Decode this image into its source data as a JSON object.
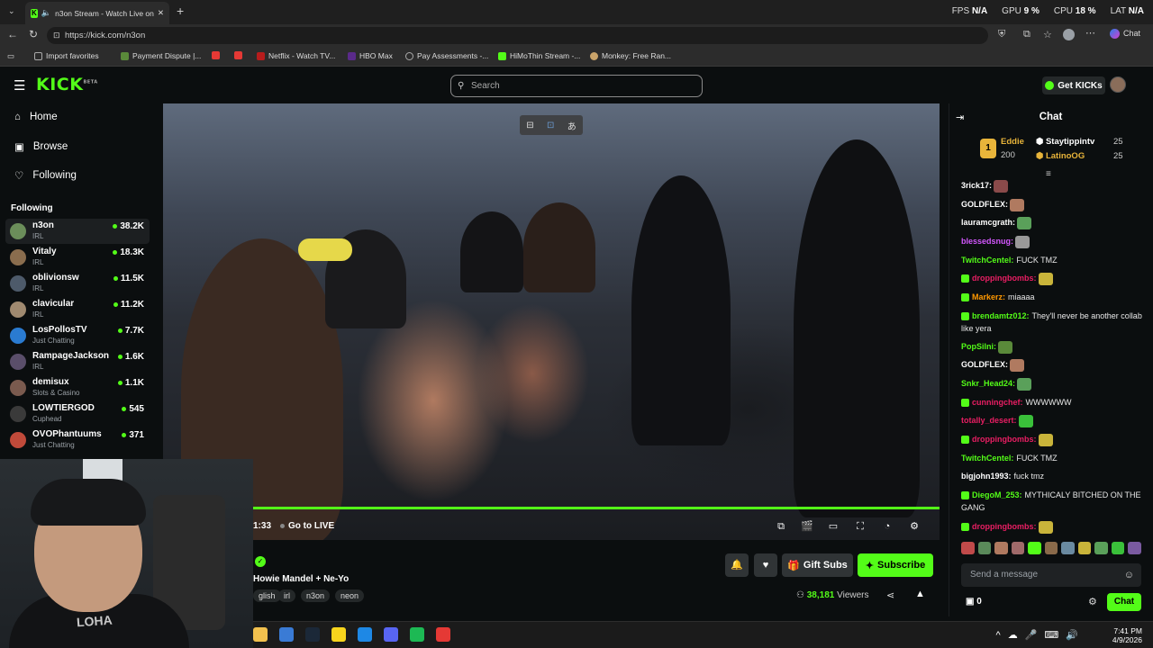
{
  "browser": {
    "tab_title": "n3on Stream - Watch Live on",
    "url": "https://kick.com/n3on",
    "stats": [
      {
        "label": "FPS",
        "value": "N/A"
      },
      {
        "label": "GPU",
        "value": "9 %"
      },
      {
        "label": "CPU",
        "value": "18 %"
      },
      {
        "label": "LAT",
        "value": "N/A"
      }
    ],
    "copilot_label": "Chat",
    "bookmarks": [
      "Import favorites",
      "Payment Dispute |...",
      "Netflix - Watch TV...",
      "HBO Max",
      "Pay Assessments -...",
      "HiMoThin Stream -...",
      "Monkey: Free Ran..."
    ]
  },
  "kick": {
    "logo": "KICK",
    "logo_sup": "BETA",
    "search_placeholder": "Search",
    "get_kicks": "Get KICKs"
  },
  "sidebar": {
    "nav": [
      {
        "label": "Home",
        "icon": "home-icon"
      },
      {
        "label": "Browse",
        "icon": "browse-icon"
      },
      {
        "label": "Following",
        "icon": "heart-icon"
      }
    ],
    "following_heading": "Following",
    "channels": [
      {
        "name": "n3on",
        "category": "IRL",
        "viewers": "38.2K",
        "color": "#6b8e5a"
      },
      {
        "name": "Vitaly",
        "category": "IRL",
        "viewers": "18.3K",
        "color": "#8a6d4e"
      },
      {
        "name": "oblivionsw",
        "category": "IRL",
        "viewers": "11.5K",
        "color": "#4d5a6a"
      },
      {
        "name": "clavicular",
        "category": "IRL",
        "viewers": "11.2K",
        "color": "#a08a70"
      },
      {
        "name": "LosPollosTV",
        "category": "Just Chatting",
        "viewers": "7.7K",
        "color": "#2a7bd1"
      },
      {
        "name": "RampageJackson",
        "category": "IRL",
        "viewers": "1.6K",
        "color": "#5a4e6a"
      },
      {
        "name": "demisux",
        "category": "Slots & Casino",
        "viewers": "1.1K",
        "color": "#7a5a4e"
      },
      {
        "name": "LOWTIERGOD",
        "category": "Cuphead",
        "viewers": "545",
        "color": "#3a3a3a"
      },
      {
        "name": "OVOPhantuums",
        "category": "Just Chatting",
        "viewers": "371",
        "color": "#c04a3a"
      }
    ]
  },
  "player": {
    "timecode": "1:33",
    "go_live": "Go to LIVE"
  },
  "stream": {
    "title": "Howie Mandel + Ne-Yo",
    "tags": [
      "glish",
      "irl",
      "n3on",
      "neon"
    ],
    "viewers_count": "38,181",
    "viewers_label": "Viewers",
    "gift_subs": "Gift Subs",
    "subscribe": "Subscribe"
  },
  "chat": {
    "title": "Chat",
    "pinned": [
      {
        "rank": "1",
        "name": "Eddie",
        "amount": "200",
        "color": "#e8b43a"
      },
      {
        "name": "Staytippintv",
        "amount": "25",
        "color": "#ffffff"
      },
      {
        "name": "LatinoOG",
        "amount": "25",
        "color": "#e8b43a"
      }
    ],
    "messages": [
      {
        "user": "3rick17:",
        "text": "",
        "color": "#ffffff",
        "emote": "#8a4a4a",
        "badge": false
      },
      {
        "user": "GOLDFLEX:",
        "text": "",
        "color": "#ffffff",
        "emote": "#b07a60",
        "badge": false
      },
      {
        "user": "lauramcgrath:",
        "text": "",
        "color": "#ffffff",
        "emote": "#5aa05a",
        "badge": false
      },
      {
        "user": "blessedsnug:",
        "text": "",
        "color": "#d357fe",
        "emote": "#999999",
        "badge": false
      },
      {
        "user": "TwitchCentel:",
        "text": "FUCK TMZ",
        "color": "#53fc18",
        "emote": "",
        "badge": false
      },
      {
        "user": "droppingbombs:",
        "text": "",
        "color": "#e91e63",
        "emote": "#c9b43a",
        "badge": true
      },
      {
        "user": "Markerz:",
        "text": "miaaaa",
        "color": "#ff9800",
        "emote": "",
        "badge": true
      },
      {
        "user": "brendamtz012:",
        "text": "They'll never be another collab like yera",
        "color": "#53fc18",
        "emote": "",
        "badge": true
      },
      {
        "user": "PopSilni:",
        "text": "",
        "color": "#53fc18",
        "emote": "#5a8a3a",
        "badge": false
      },
      {
        "user": "GOLDFLEX:",
        "text": "",
        "color": "#ffffff",
        "emote": "#b07a60",
        "badge": false
      },
      {
        "user": "Snkr_Head24:",
        "text": "",
        "color": "#53fc18",
        "emote": "#5aa05a",
        "badge": false
      },
      {
        "user": "cunningchef:",
        "text": "WWWWWW",
        "color": "#e91e63",
        "emote": "",
        "badge": true
      },
      {
        "user": "totally_desert:",
        "text": "",
        "color": "#e91e63",
        "emote": "#3ac03a",
        "badge": false
      },
      {
        "user": "droppingbombs:",
        "text": "",
        "color": "#e91e63",
        "emote": "#c9b43a",
        "badge": true
      },
      {
        "user": "TwitchCentel:",
        "text": "FUCK TMZ",
        "color": "#53fc18",
        "emote": "",
        "badge": false
      },
      {
        "user": "bigjohn1993:",
        "text": "fuck tmz",
        "color": "#ffffff",
        "emote": "",
        "badge": false
      },
      {
        "user": "DiegoM_253:",
        "text": "MYTHICALY BITCHED ON THE GANG",
        "color": "#53fc18",
        "emote": "",
        "badge": true
      },
      {
        "user": "droppingbombs:",
        "text": "",
        "color": "#e91e63",
        "emote": "#c9b43a",
        "badge": true
      }
    ],
    "emote_colors": [
      "#c04a4a",
      "#5a8a5a",
      "#b07a60",
      "#a06a6a",
      "#53fc18",
      "#8a6a4a",
      "#6a8aa0",
      "#c9b43a",
      "#5aa05a",
      "#3ac03a",
      "#7a5aa0"
    ],
    "input_placeholder": "Send a message",
    "kicks_count": "0",
    "send_label": "Chat"
  },
  "taskbar": {
    "time": "7:41 PM",
    "date": "4/9/2026",
    "apps": [
      {
        "name": "file-explorer-icon",
        "color": "#f2c14e"
      },
      {
        "name": "store-icon",
        "color": "#3a7bd5"
      },
      {
        "name": "steam-icon",
        "color": "#1b2838"
      },
      {
        "name": "sticky-notes-icon",
        "color": "#f7d51d"
      },
      {
        "name": "app-blue-icon",
        "color": "#1e88e5"
      },
      {
        "name": "discord-icon",
        "color": "#5865f2"
      },
      {
        "name": "spotify-icon",
        "color": "#1db954"
      },
      {
        "name": "app-red-icon",
        "color": "#e53935"
      }
    ]
  }
}
